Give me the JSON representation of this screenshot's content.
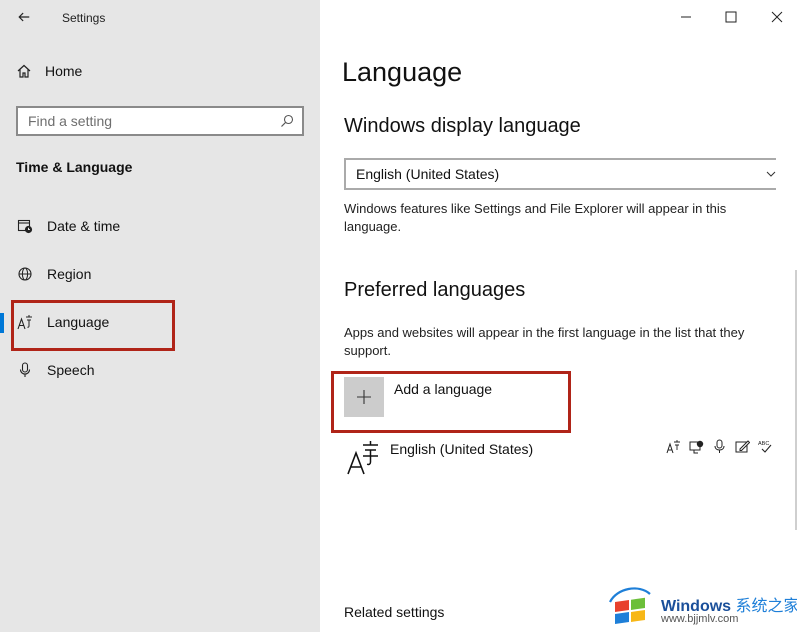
{
  "window": {
    "title": "Settings"
  },
  "sidebar": {
    "home_label": "Home",
    "search_placeholder": "Find a setting",
    "section_title": "Time & Language",
    "items": [
      {
        "label": "Date & time",
        "icon": "date-time-icon"
      },
      {
        "label": "Region",
        "icon": "globe-icon"
      },
      {
        "label": "Language",
        "icon": "language-icon",
        "active": true
      },
      {
        "label": "Speech",
        "icon": "microphone-icon"
      }
    ]
  },
  "main": {
    "title": "Language",
    "display_language": {
      "heading": "Windows display language",
      "selected": "English (United States)",
      "description": "Windows features like Settings and File Explorer will appear in this language."
    },
    "preferred": {
      "heading": "Preferred languages",
      "description": "Apps and websites will appear in the first language in the list that they support.",
      "add_label": "Add a language",
      "languages": [
        {
          "name": "English (United States)",
          "features": [
            "display-language-icon",
            "text-to-speech-icon",
            "speech-icon",
            "handwriting-icon",
            "spellcheck-icon"
          ]
        }
      ]
    },
    "related_heading": "Related settings"
  },
  "watermark": {
    "brand": "Windows",
    "brand_cn": "系统之家",
    "url": "www.bjjmlv.com"
  },
  "colors": {
    "accent": "#0078d7",
    "highlight": "#b02418",
    "sidebar_bg": "#e6e6e6"
  }
}
